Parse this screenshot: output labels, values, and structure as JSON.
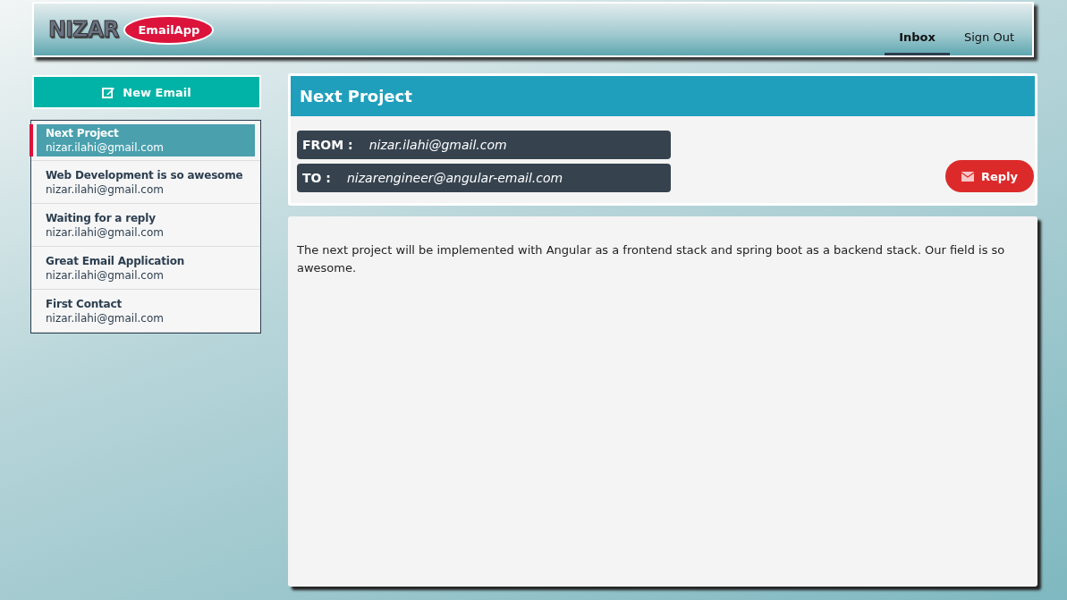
{
  "header": {
    "logo": "NIZAR",
    "badge": "EmailApp",
    "nav": [
      {
        "label": "Inbox",
        "selected": true
      },
      {
        "label": "Sign Out",
        "selected": false
      }
    ]
  },
  "sidebar": {
    "new_email_button": "New Email",
    "emails": [
      {
        "subject": "Next Project",
        "sender": "nizar.ilahi@gmail.com",
        "selected": true
      },
      {
        "subject": "Web Development is so awesome",
        "sender": "nizar.ilahi@gmail.com",
        "selected": false
      },
      {
        "subject": "Waiting for a reply",
        "sender": "nizar.ilahi@gmail.com",
        "selected": false
      },
      {
        "subject": "Great Email Application",
        "sender": "nizar.ilahi@gmail.com",
        "selected": false
      },
      {
        "subject": "First Contact",
        "sender": "nizar.ilahi@gmail.com",
        "selected": false
      }
    ]
  },
  "message": {
    "title": "Next Project",
    "from_label": "FROM :",
    "from": "nizar.ilahi@gmail.com",
    "to_label": "TO :",
    "to": "nizarengineer@angular-email.com",
    "reply_button": "Reply",
    "body": "The next project will be implemented with Angular as a frontend stack and spring boot as a backend stack. Our field is so awesome."
  }
}
